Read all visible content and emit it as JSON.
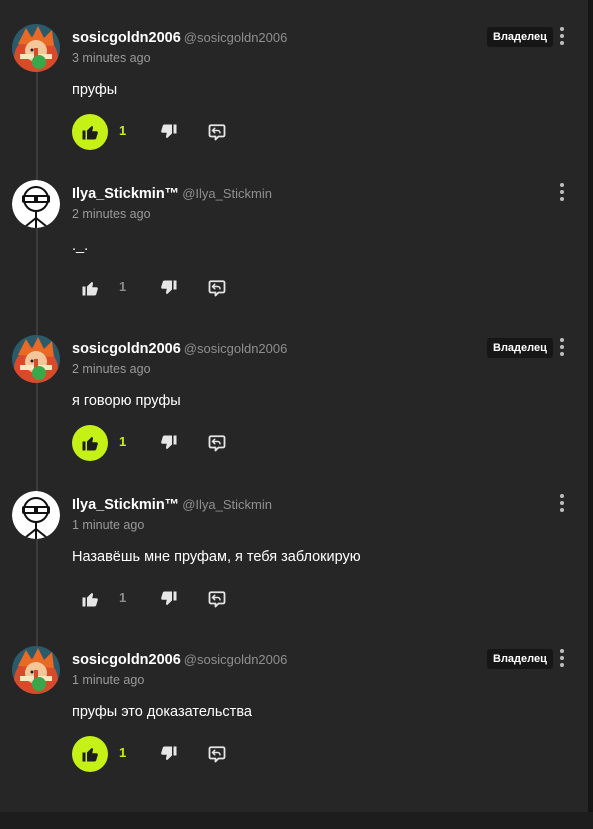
{
  "comments": [
    {
      "username": "sosicgoldn2006",
      "handle": "@sosicgoldn2006",
      "time": "3 minutes ago",
      "badge": "Владелец",
      "text": "пруфы",
      "likes": "1",
      "liked": true
    },
    {
      "username": "Ilya_Stickmin™",
      "handle": "@Ilya_Stickmin",
      "time": "2 minutes ago",
      "badge": "",
      "text": "._.",
      "likes": "1",
      "liked": false
    },
    {
      "username": "sosicgoldn2006",
      "handle": "@sosicgoldn2006",
      "time": "2 minutes ago",
      "badge": "Владелец",
      "text": "я говорю пруфы",
      "likes": "1",
      "liked": true
    },
    {
      "username": "Ilya_Stickmin™",
      "handle": "@Ilya_Stickmin",
      "time": "1 minute ago",
      "badge": "",
      "text": "Назавёшь мне пруфам, я тебя заблокирую",
      "likes": "1",
      "liked": false
    },
    {
      "username": "sosicgoldn2006",
      "handle": "@sosicgoldn2006",
      "time": "1 minute ago",
      "badge": "Владелец",
      "text": "пруфы это доказательства",
      "likes": "1",
      "liked": true
    }
  ],
  "colors": {
    "accent": "#c6f116",
    "panel": "#262626",
    "muted_text": "#9a9a9a"
  },
  "icons": {
    "like": "thumbs-up-icon",
    "dislike": "thumbs-down-icon",
    "reply": "reply-icon",
    "more": "kebab-menu-icon"
  }
}
